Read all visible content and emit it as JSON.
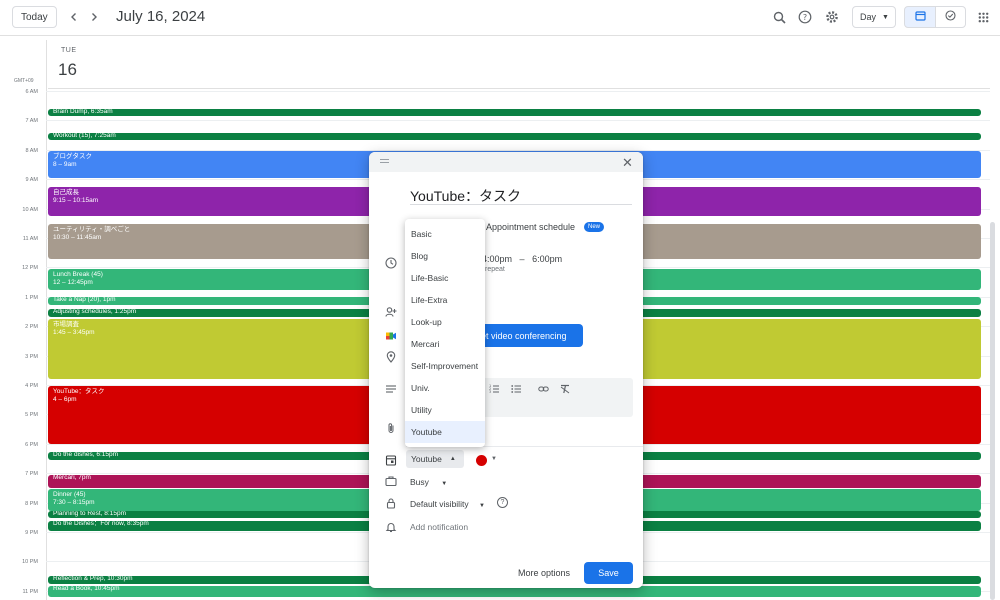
{
  "header": {
    "today_label": "Today",
    "date_title": "July 16, 2024",
    "view_label": "Day",
    "icons": [
      "chevron-left-icon",
      "chevron-right-icon",
      "search-icon",
      "help-icon",
      "gear-icon",
      "calendar-icon",
      "task-check-icon",
      "apps-grid-icon"
    ]
  },
  "day": {
    "name": "TUE",
    "number": "16",
    "timezone": "GMT+09"
  },
  "time_labels": [
    "6 AM",
    "7 AM",
    "8 AM",
    "9 AM",
    "10 AM",
    "11 AM",
    "12 PM",
    "1 PM",
    "2 PM",
    "3 PM",
    "4 PM",
    "5 PM",
    "6 PM",
    "7 PM",
    "8 PM",
    "9 PM",
    "10 PM",
    "11 PM"
  ],
  "events": [
    {
      "title": "Brain Dump, 6:35am",
      "color": "#0b8043"
    },
    {
      "title": "Workout (15), 7:25am",
      "color": "#0b8043"
    },
    {
      "title": "ブログタスク",
      "time": "8 – 9am",
      "color": "#4285f4"
    },
    {
      "title": "自己成長",
      "time": "9:15 – 10:15am",
      "color": "#8e24aa"
    },
    {
      "title": "ユーティリティ・調べごと",
      "time": "10:30 – 11:45am",
      "color": "#a79b8e"
    },
    {
      "title": "Lunch Break (45)",
      "time": "12 – 12:45pm",
      "color": "#33b679"
    },
    {
      "title": "Take a Nap (20), 1pm",
      "color": "#33b679"
    },
    {
      "title": "Adjusting schedules, 1:25pm",
      "color": "#0b8043"
    },
    {
      "title": "市場調査",
      "time": "1:45 – 3:45pm",
      "color": "#c0ca33"
    },
    {
      "title": "YouTube：タスク",
      "time": "4 – 6pm",
      "color": "#d50000"
    },
    {
      "title": "Do the dishes, 6:15pm",
      "color": "#0b8043"
    },
    {
      "title": "Mercari, 7pm",
      "color": "#ad1457"
    },
    {
      "title": "Dinner (45)",
      "time": "7:30 – 8:15pm",
      "color": "#33b679"
    },
    {
      "title": "Planning to Rest, 8:15pm",
      "color": "#0b8043"
    },
    {
      "title": "Do the Dishes：For now, 8:35pm",
      "color": "#0b8043"
    },
    {
      "title": "Reflection & Prep, 10:30pm",
      "color": "#0b8043"
    },
    {
      "title": "Read a Book, 10:45pm",
      "color": "#33b679"
    }
  ],
  "dialog": {
    "title": "YouTube：タスク",
    "appointment_label": "Appointment schedule",
    "new_badge": "New",
    "time_start": "4:00pm",
    "time_sep": "–",
    "time_end": "6:00pm",
    "repeat_text": "repeat",
    "video_label": "et video conferencing",
    "calendar_value": "Youtube",
    "event_color": "#d50000",
    "busy_label": "Busy",
    "visibility_label": "Default visibility",
    "notification_placeholder": "Add notification",
    "more_options_label": "More options",
    "save_label": "Save"
  },
  "calendar_dropdown": {
    "options": [
      "Basic",
      "Blog",
      "Life-Basic",
      "Life-Extra",
      "Look-up",
      "Mercari",
      "Self-Improvement",
      "Univ.",
      "Utility",
      "Youtube"
    ],
    "selected": "Youtube"
  }
}
